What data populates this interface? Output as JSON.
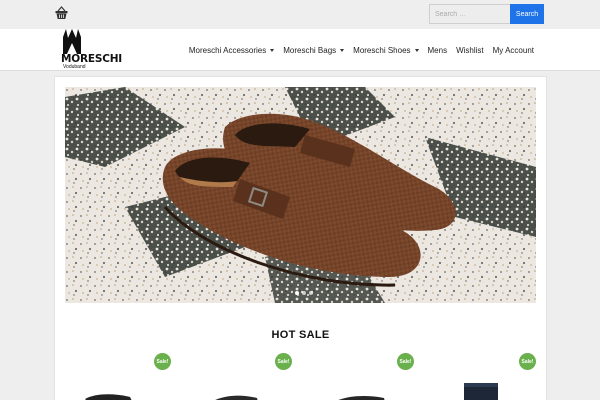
{
  "topbar": {
    "cart_icon": "shopping-basket-icon",
    "search": {
      "placeholder": "Search …",
      "button_label": "Search"
    }
  },
  "header": {
    "logo": {
      "wordmark": "MORESCHI",
      "subtitle": "Voduband"
    },
    "nav": [
      {
        "label": "Moreschi Accessories",
        "has_dropdown": true
      },
      {
        "label": "Moreschi Bags",
        "has_dropdown": true
      },
      {
        "label": "Moreschi Shoes",
        "has_dropdown": true
      },
      {
        "label": "Mens",
        "has_dropdown": false
      },
      {
        "label": "Wishlist",
        "has_dropdown": false
      },
      {
        "label": "My Account",
        "has_dropdown": false
      }
    ]
  },
  "hero": {
    "image": "brown woven leather loafers with buckle strap on terrazzo floor",
    "slides": 3,
    "active_slide": 1
  },
  "hot_sale": {
    "title": "HOT SALE",
    "badges": [
      "Sale!",
      "Sale!",
      "Sale!",
      "Sale!"
    ]
  },
  "colors": {
    "accent": "#1e73e8",
    "sale_badge": "#6ab04c",
    "background": "#eeeeee"
  }
}
